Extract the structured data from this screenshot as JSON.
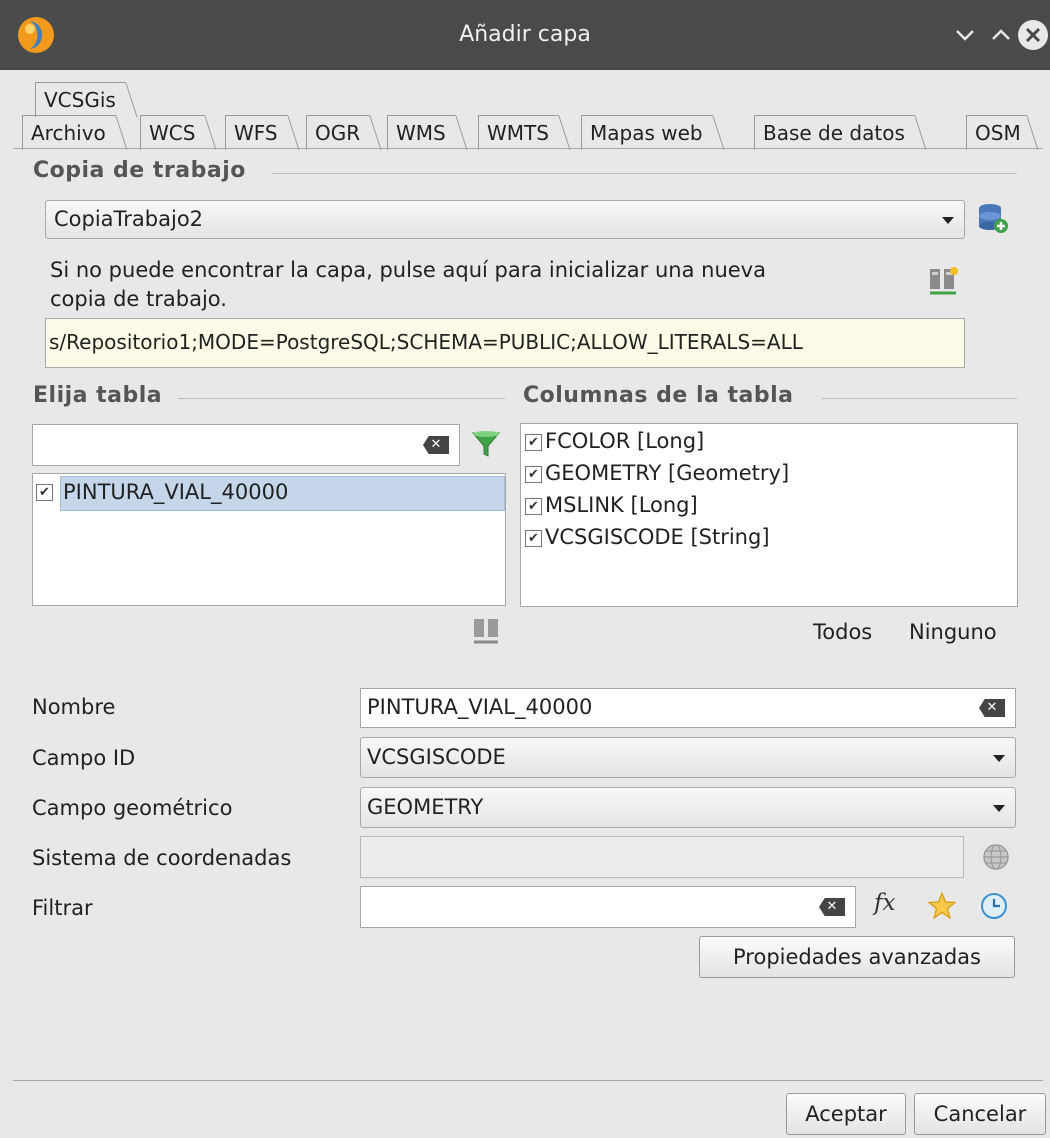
{
  "window": {
    "title": "Añadir capa",
    "controls": [
      "minimize",
      "maximize",
      "close"
    ]
  },
  "tabs": {
    "row1": [
      {
        "label": "VCSGis"
      }
    ],
    "row2": [
      {
        "label": "Archivo"
      },
      {
        "label": "WCS"
      },
      {
        "label": "WFS"
      },
      {
        "label": "OGR"
      },
      {
        "label": "WMS"
      },
      {
        "label": "WMTS"
      },
      {
        "label": "Mapas web"
      },
      {
        "label": "Base de datos"
      },
      {
        "label": "OSM"
      }
    ]
  },
  "working_copy": {
    "section_title": "Copia de trabajo",
    "selected": "CopiaTrabajo2",
    "hint": "Si no puede encontrar la capa, pulse aquí para inicializar una nueva copia de trabajo.",
    "hint_line1": "Si no puede encontrar la capa, pulse aquí para inicializar una nueva",
    "hint_line2": "copia de trabajo.",
    "connection_string": "s/Repositorio1;MODE=PostgreSQL;SCHEMA=PUBLIC;ALLOW_LITERALS=ALL"
  },
  "tables": {
    "section_title": "Elija tabla",
    "filter_value": "",
    "items": [
      {
        "label": "PINTURA_VIAL_40000",
        "checked": true,
        "selected": true
      }
    ]
  },
  "columns": {
    "section_title": "Columnas de la tabla",
    "items": [
      {
        "label": "FCOLOR [Long]",
        "checked": true
      },
      {
        "label": "GEOMETRY [Geometry]",
        "checked": true
      },
      {
        "label": "MSLINK [Long]",
        "checked": true
      },
      {
        "label": "VCSGISCODE [String]",
        "checked": true
      }
    ],
    "all_label": "Todos",
    "none_label": "Ninguno"
  },
  "form": {
    "name_label": "Nombre",
    "name_value": "PINTURA_VIAL_40000",
    "id_field_label": "Campo ID",
    "id_field_value": "VCSGISCODE",
    "geom_field_label": "Campo geométrico",
    "geom_field_value": "GEOMETRY",
    "crs_label": "Sistema de coordenadas",
    "crs_value": "",
    "filter_label": "Filtrar",
    "filter_value": "",
    "advanced_label": "Propiedades avanzadas"
  },
  "footer": {
    "accept_label": "Aceptar",
    "cancel_label": "Cancelar"
  },
  "colors": {
    "titlebar": "#4a4a4a",
    "selection": "#c5d5ea",
    "logo_orange": "#f39a1c",
    "logo_blue": "#3f7fc1"
  }
}
